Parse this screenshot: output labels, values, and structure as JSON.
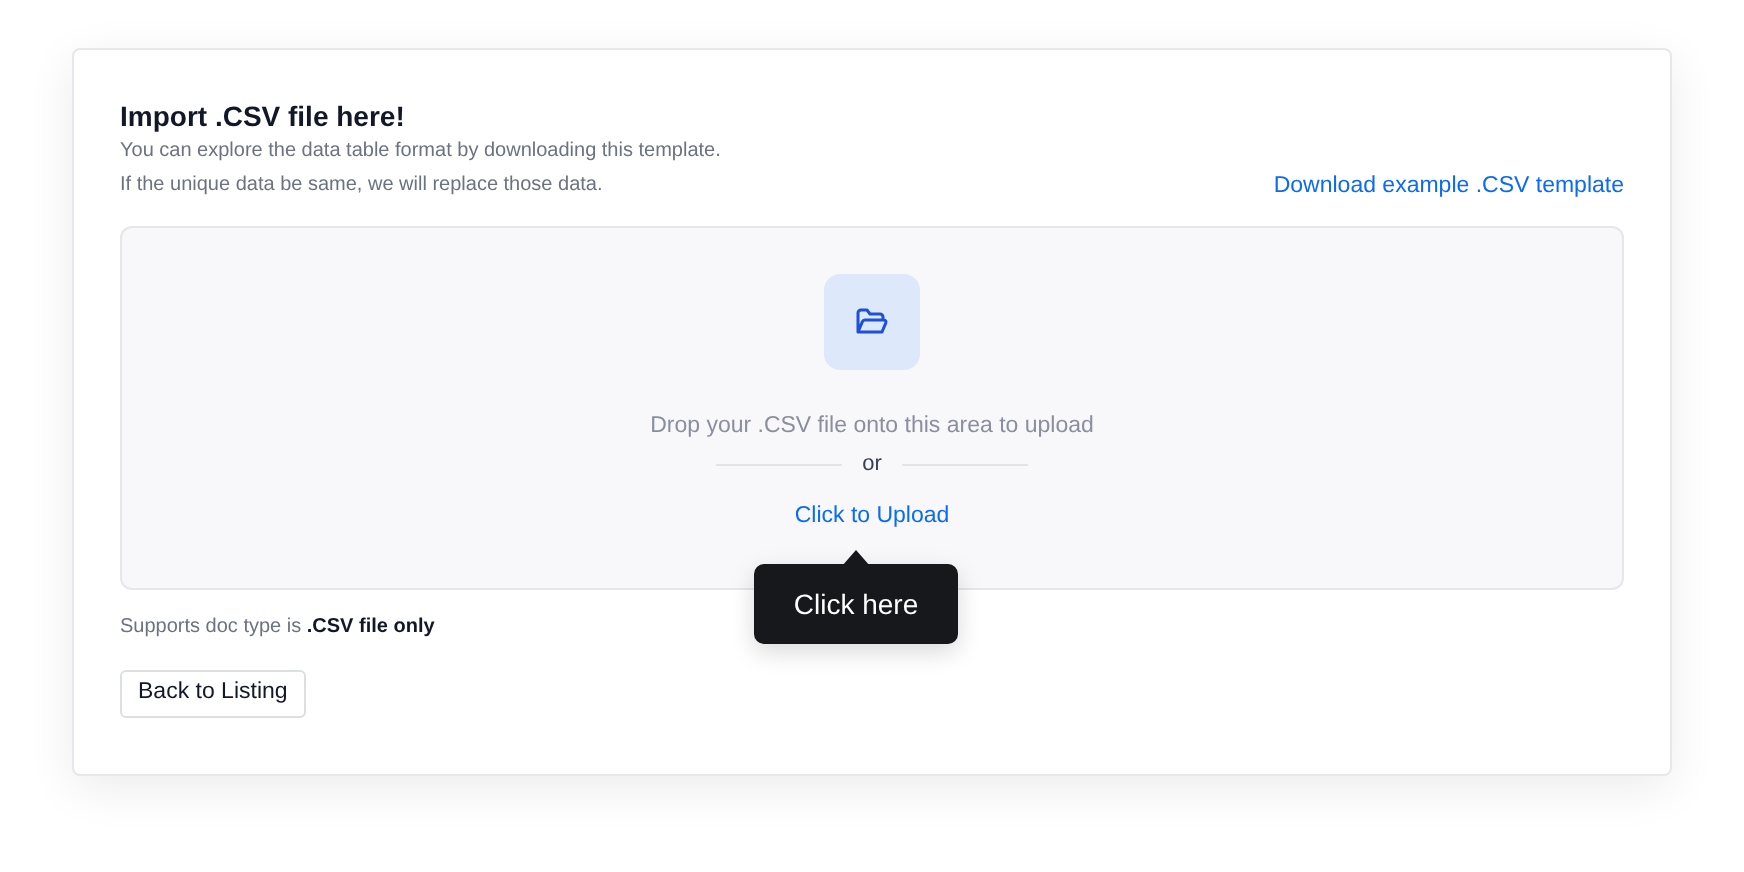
{
  "header": {
    "title": "Import .CSV file here!",
    "lines": [
      "You can explore the data table format by downloading this template.",
      "If the unique data be same, we will replace those data."
    ],
    "download_link": "Download example .CSV template"
  },
  "dropzone": {
    "instruction": "Drop your .CSV file onto this area to upload",
    "separator": "or",
    "upload_link": "Click to Upload",
    "tooltip": "Click here"
  },
  "note": "Supports doc type is **.CSV file only**",
  "buttons": [
    "Back to Listing"
  ]
}
